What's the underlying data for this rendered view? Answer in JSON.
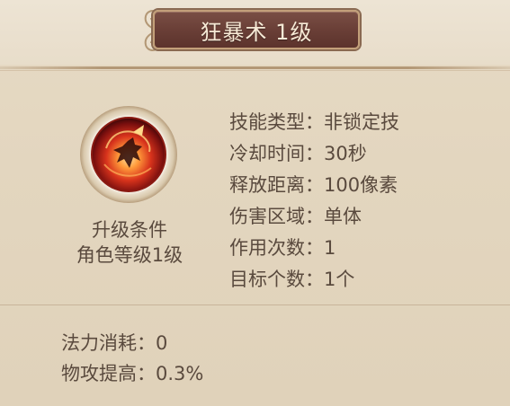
{
  "title": "狂暴术 1级",
  "skill_icon": "berserk-skill-icon",
  "upgrade": {
    "title": "升级条件",
    "requirement": "角色等级1级"
  },
  "stats": [
    {
      "label": "技能类型：",
      "value": "非锁定技"
    },
    {
      "label": "冷却时间：",
      "value": "30秒"
    },
    {
      "label": "释放距离：",
      "value": "100像素"
    },
    {
      "label": "伤害区域：",
      "value": "单体"
    },
    {
      "label": "作用次数：",
      "value": "1"
    },
    {
      "label": "目标个数：",
      "value": "1个"
    }
  ],
  "effects": [
    {
      "label": "法力消耗：",
      "value": "0"
    },
    {
      "label": "物攻提高：",
      "value": "0.3%"
    }
  ],
  "colors": {
    "panel_bg": "#e3d6bf",
    "title_plate": "#6a3f37",
    "title_text": "#f7ead6",
    "body_text": "#5a4a3e"
  }
}
